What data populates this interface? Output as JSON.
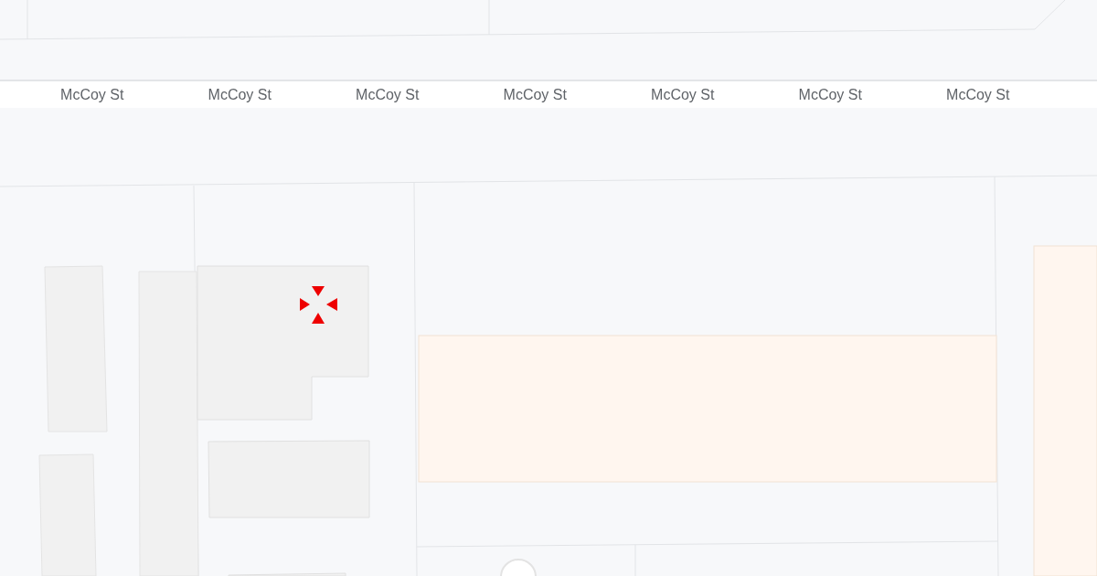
{
  "map": {
    "street_labels": [
      "McCoy St",
      "McCoy St",
      "McCoy St",
      "McCoy St",
      "McCoy St",
      "McCoy St",
      "McCoy St"
    ]
  }
}
